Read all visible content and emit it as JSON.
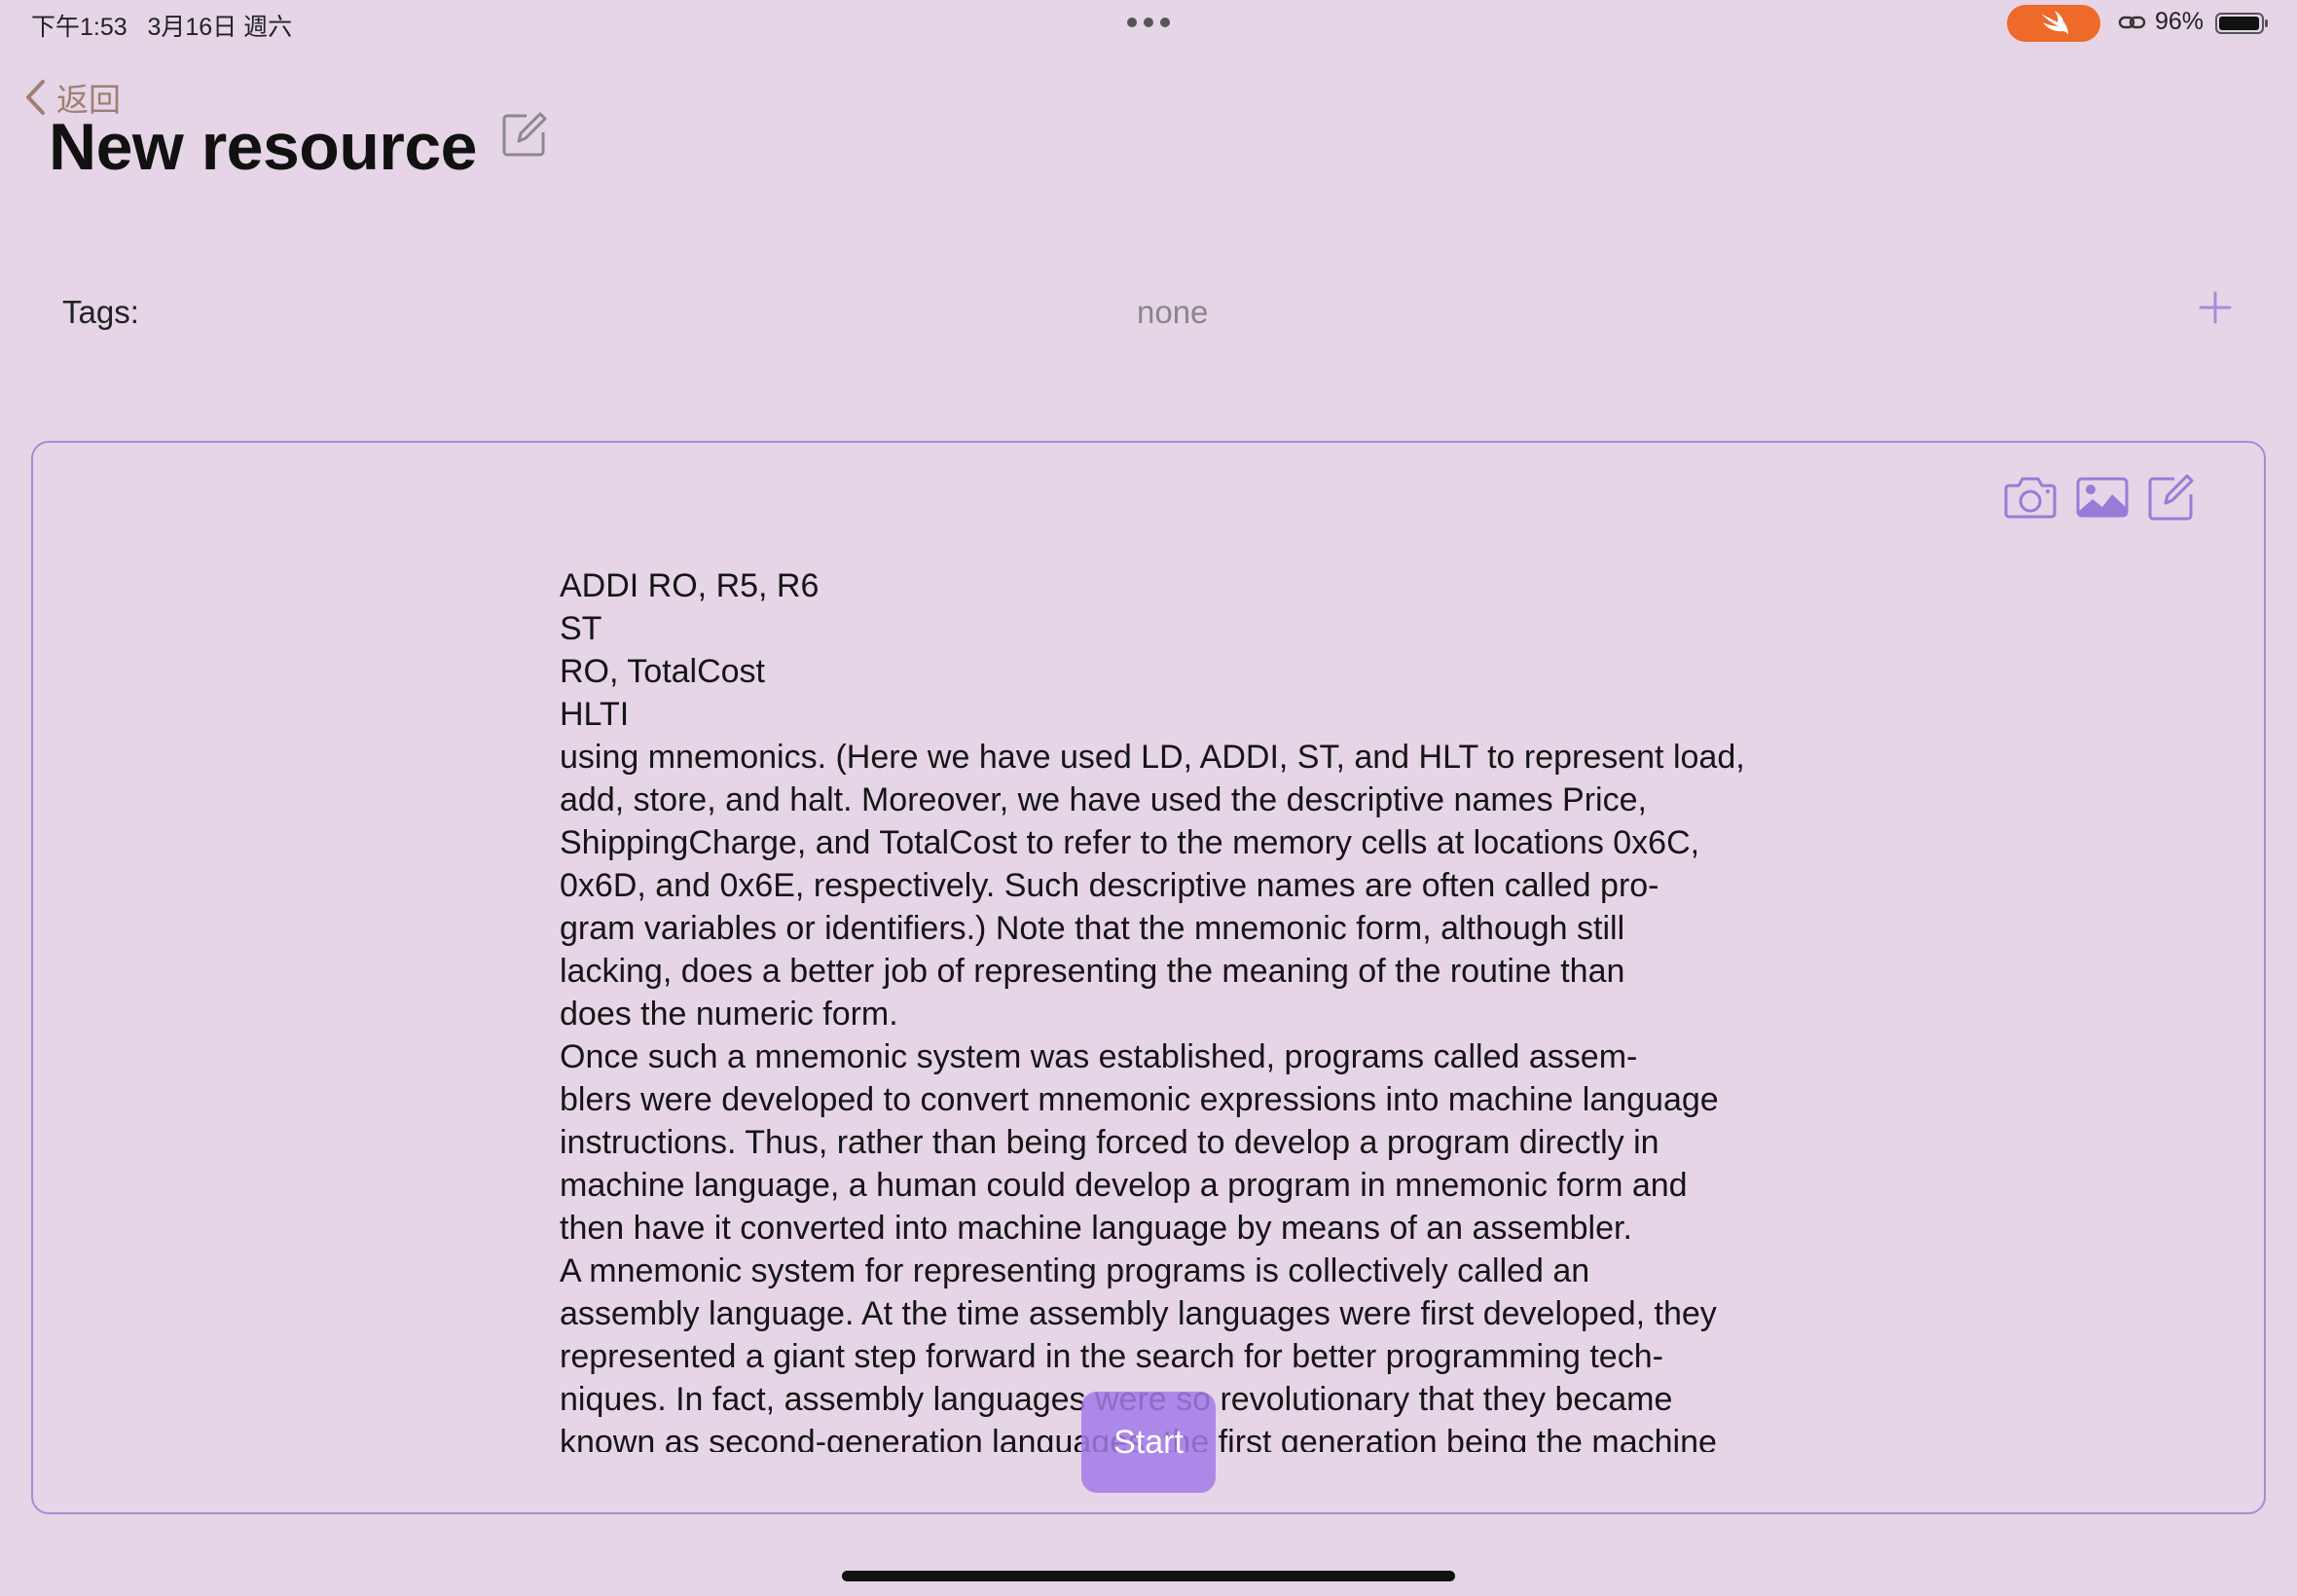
{
  "status_bar": {
    "time": "下午1:53   3月16日 週六",
    "battery_pct": "96%",
    "icons": [
      "multitask-dots-icon",
      "swift-icon",
      "link-icon",
      "battery-icon"
    ]
  },
  "nav": {
    "back_label": "返回",
    "title": "New resource"
  },
  "tags": {
    "label": "Tags:",
    "value": "none"
  },
  "content": {
    "lines": [
      "ADDI RO, R5, R6",
      "ST",
      "RO, TotalCost",
      "HLTI",
      "using mnemonics. (Here we have used LD, ADDI, ST, and HLT to represent load,",
      "add, store, and halt. Moreover, we have used the descriptive names Price,",
      "ShippingCharge, and TotalCost to refer to the memory cells at locations 0x6C,",
      "0x6D, and 0x6E, respectively. Such descriptive names are often called pro-",
      "gram variables or identifiers.) Note that the mnemonic form, although still",
      "lacking, does a better job of representing the meaning of the routine than",
      "does the numeric form.",
      "Once such a mnemonic system was established, programs called assem-",
      "blers were developed to convert mnemonic expressions into machine language",
      "instructions. Thus, rather than being forced to develop a program directly in",
      "machine language, a human could develop a program in mnemonic form and",
      "then have it converted into machine language by means of an assembler.",
      "A mnemonic system for representing programs is collectively called an",
      "assembly language. At the time assembly languages were first developed, they",
      "represented a giant step forward in the search for better programming tech-",
      "niques. In fact, assembly languages were so revolutionary that they became",
      "known as second-generation languages, the first generation being the machine"
    ]
  },
  "start_button": {
    "label": "Start"
  },
  "colors": {
    "background": "#e5d5e6",
    "accent": "#a98ad8",
    "back": "#a07f73",
    "swift": "#ee6a2a"
  }
}
